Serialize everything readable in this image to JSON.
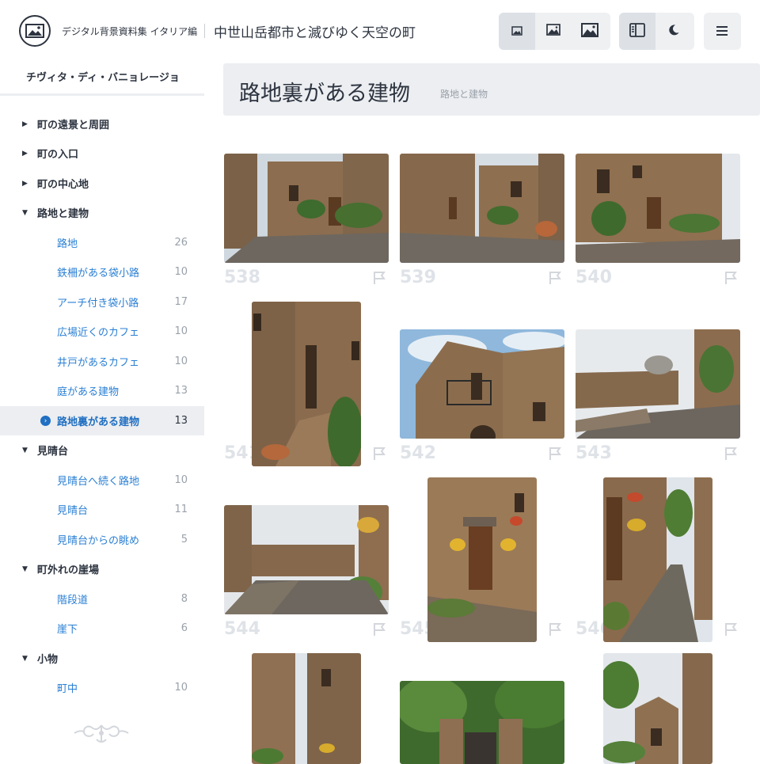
{
  "header": {
    "brand": "デジタル背景資料集 イタリア編",
    "title": "中世山岳都市と滅びゆく天空の町",
    "icons": {
      "logo": "landscape-logo-icon",
      "size_small": "image-small-icon",
      "size_medium": "image-medium-icon",
      "size_large": "image-large-icon",
      "sidebar_toggle": "sidebar-icon",
      "dark_mode": "moon-icon",
      "menu": "hamburger-icon"
    }
  },
  "sidebar": {
    "town": "チヴィタ・ディ・バニョレージョ",
    "categories": [
      {
        "label": "町の遠景と周囲",
        "expanded": false
      },
      {
        "label": "町の入口",
        "expanded": false
      },
      {
        "label": "町の中心地",
        "expanded": false
      },
      {
        "label": "路地と建物",
        "expanded": true,
        "items": [
          {
            "label": "路地",
            "count": "26"
          },
          {
            "label": "鉄柵がある袋小路",
            "count": "10"
          },
          {
            "label": "アーチ付き袋小路",
            "count": "17"
          },
          {
            "label": "広場近くのカフェ",
            "count": "10"
          },
          {
            "label": "井戸があるカフェ",
            "count": "10"
          },
          {
            "label": "庭がある建物",
            "count": "13"
          },
          {
            "label": "路地裏がある建物",
            "count": "13",
            "current": true
          }
        ]
      },
      {
        "label": "見晴台",
        "expanded": true,
        "items": [
          {
            "label": "見晴台へ続く路地",
            "count": "10"
          },
          {
            "label": "見晴台",
            "count": "11"
          },
          {
            "label": "見晴台からの眺め",
            "count": "5"
          }
        ]
      },
      {
        "label": "町外れの崖場",
        "expanded": true,
        "items": [
          {
            "label": "階段道",
            "count": "8"
          },
          {
            "label": "崖下",
            "count": "6"
          }
        ]
      },
      {
        "label": "小物",
        "expanded": true,
        "items": [
          {
            "label": "町中",
            "count": "10"
          }
        ]
      }
    ]
  },
  "section": {
    "title": "路地裏がある建物",
    "breadcrumb": "路地と建物"
  },
  "photos": [
    {
      "number": "538",
      "orientation": "landscape"
    },
    {
      "number": "539",
      "orientation": "landscape"
    },
    {
      "number": "540",
      "orientation": "landscape"
    },
    {
      "number": "541",
      "orientation": "portrait"
    },
    {
      "number": "542",
      "orientation": "landscape"
    },
    {
      "number": "543",
      "orientation": "landscape"
    },
    {
      "number": "544",
      "orientation": "landscape"
    },
    {
      "number": "545",
      "orientation": "portrait"
    },
    {
      "number": "546",
      "orientation": "portrait"
    },
    {
      "number": "",
      "orientation": "portrait"
    },
    {
      "number": "",
      "orientation": "landscape"
    },
    {
      "number": "",
      "orientation": "portrait"
    }
  ],
  "colors": {
    "accent": "#2a7fd4",
    "stone": "#8a6c4e",
    "sky": "#dde6ee",
    "foliage": "#3e6b2e"
  }
}
